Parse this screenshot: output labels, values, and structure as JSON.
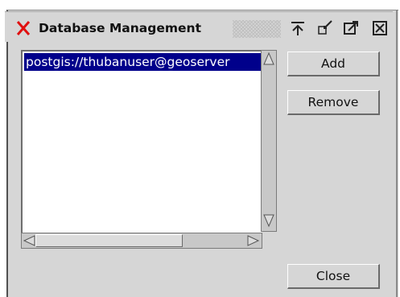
{
  "window": {
    "title": "Database Management"
  },
  "titlebar_icons": {
    "close": "close-icon",
    "pin": "pin-icon",
    "shade": "shade-icon",
    "maximize": "maximize-icon",
    "kill": "kill-icon"
  },
  "list": {
    "items": [
      {
        "label": "postgis://thubanuser@geoserver",
        "selected": true
      }
    ]
  },
  "buttons": {
    "add": "Add",
    "remove": "Remove",
    "close": "Close"
  },
  "colors": {
    "selection_bg": "#00008b",
    "close_icon": "#e01010"
  }
}
